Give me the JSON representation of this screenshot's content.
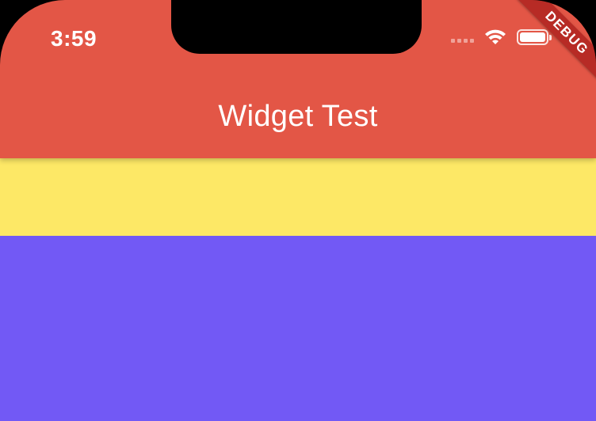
{
  "status_bar": {
    "time": "3:59",
    "icons": [
      "cellular-signal-icon",
      "wifi-icon",
      "battery-icon"
    ]
  },
  "app_bar": {
    "title": "Widget Test"
  },
  "debug_banner": {
    "label": "DEBUG"
  },
  "colors": {
    "app_bar": "#E35646",
    "yellow_container": "#FDE866",
    "purple_container": "#7259F5",
    "text": "#FFFFFF"
  }
}
